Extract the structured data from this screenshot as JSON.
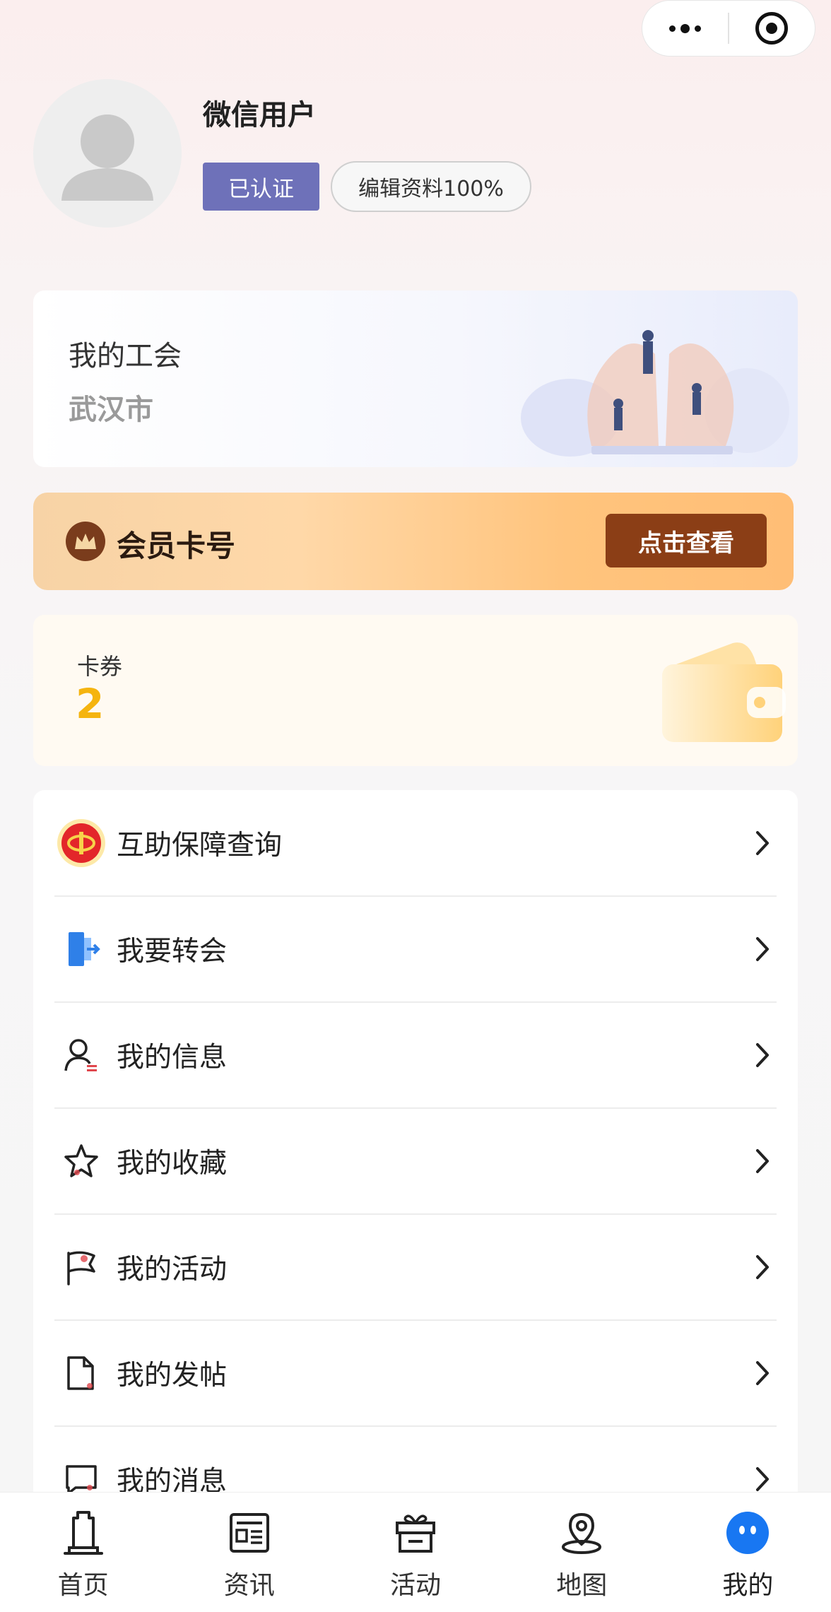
{
  "capsule": {
    "more_icon": "more-dots-icon",
    "close_icon": "close-target-icon"
  },
  "profile": {
    "username": "微信用户",
    "verified_label": "已认证",
    "edit_label": "编辑资料100%"
  },
  "union": {
    "title": "我的工会",
    "name": "武汉市"
  },
  "member": {
    "label": "会员卡号",
    "button": "点击查看"
  },
  "coupon": {
    "label": "卡券",
    "count": "2"
  },
  "menu": {
    "items": [
      {
        "label": "互助保障查询",
        "icon": "union-emblem-icon"
      },
      {
        "label": "我要转会",
        "icon": "transfer-door-icon"
      },
      {
        "label": "我的信息",
        "icon": "user-info-icon"
      },
      {
        "label": "我的收藏",
        "icon": "star-icon"
      },
      {
        "label": "我的活动",
        "icon": "flag-icon"
      },
      {
        "label": "我的发帖",
        "icon": "document-icon"
      },
      {
        "label": "我的消息",
        "icon": "message-icon"
      }
    ]
  },
  "tabbar": {
    "tabs": [
      {
        "label": "首页",
        "icon": "home-tower-icon"
      },
      {
        "label": "资讯",
        "icon": "news-icon"
      },
      {
        "label": "活动",
        "icon": "gift-icon"
      },
      {
        "label": "地图",
        "icon": "map-pin-icon"
      },
      {
        "label": "我的",
        "icon": "profile-face-icon"
      }
    ],
    "active": "我的"
  },
  "colors": {
    "verified_bg": "#6e71b9",
    "member_button": "#8b3e16",
    "coupon_count": "#f5b40f",
    "active_tab": "#1877f2"
  }
}
